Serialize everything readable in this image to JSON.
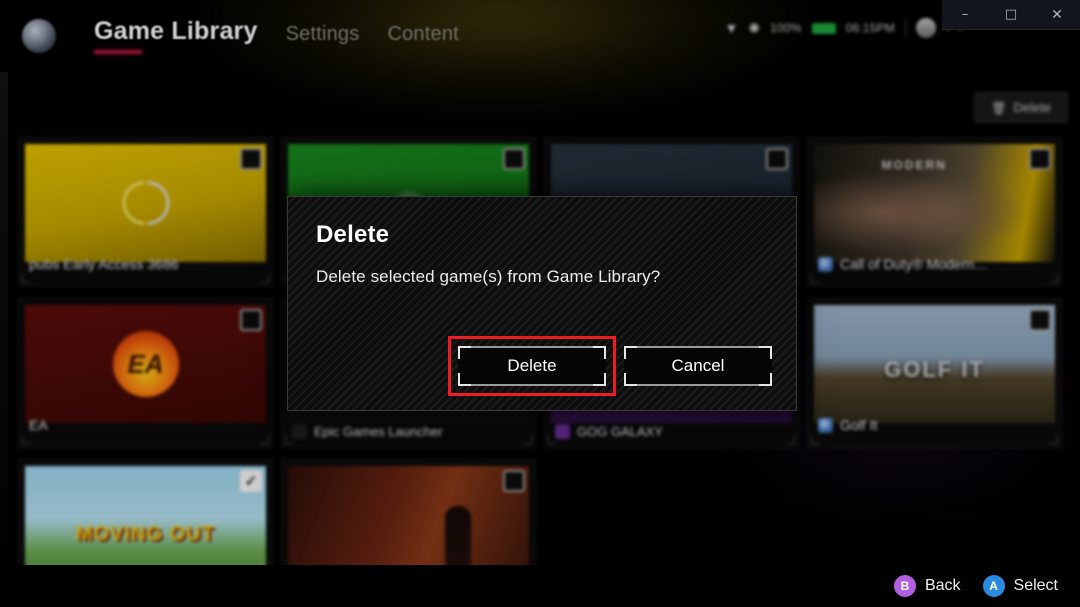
{
  "window": {
    "controls": [
      {
        "name": "minimize",
        "glyph": "–"
      },
      {
        "name": "maximize",
        "glyph": "□"
      },
      {
        "name": "close",
        "glyph": "✕"
      }
    ]
  },
  "header": {
    "logo_icon": "app-logo-icon",
    "nav": [
      {
        "label": "Game Library",
        "active": true
      },
      {
        "label": "Settings",
        "active": false
      },
      {
        "label": "Content",
        "active": false
      }
    ]
  },
  "tray": {
    "wifi_icon": "wifi-icon",
    "bluetooth_icon": "bluetooth-icon",
    "battery_percent": "100%",
    "battery_icon": "battery-icon",
    "time": "06:15PM",
    "user_icon": "user-avatar-icon",
    "chevron_left": "‹",
    "chevron_right": "›"
  },
  "toolbar": {
    "delete_label": "Delete",
    "delete_icon": "trash-icon"
  },
  "tiles": [
    {
      "title": "pubs Early Access 3686",
      "art": "art-yellow",
      "logo": "yuzu",
      "checked": false,
      "caption_on_art": true,
      "cap_icon": ""
    },
    {
      "title": "",
      "art": "art-green",
      "logo": "xbox",
      "checked": false,
      "caption_on_art": false,
      "cap_icon": ""
    },
    {
      "title": "",
      "art": "art-blue",
      "logo": "steam",
      "checked": false,
      "caption_on_art": false,
      "cap_icon": ""
    },
    {
      "title": "Call of Duty® Modern…",
      "art": "art-cod",
      "logo": "cod",
      "checked": false,
      "caption_on_art": true,
      "cap_icon": "cap-ico-blue"
    },
    {
      "title": "EA",
      "art": "art-ea",
      "logo": "ea",
      "checked": false,
      "caption_on_art": true,
      "cap_icon": ""
    },
    {
      "title": "Epic Games Launcher",
      "art": "art-epic",
      "logo": "none",
      "checked": false,
      "caption_on_art": false,
      "cap_icon": "cap-ico-epic"
    },
    {
      "title": "GOG GALAXY",
      "art": "art-gog",
      "logo": "gog",
      "checked": false,
      "caption_on_art": false,
      "cap_icon": "cap-ico-gog"
    },
    {
      "title": "Golf It",
      "art": "art-golf",
      "logo": "golf",
      "checked": false,
      "caption_on_art": true,
      "cap_icon": "cap-ico-blue"
    },
    {
      "title": "",
      "art": "art-moving",
      "logo": "moving",
      "checked": true,
      "caption_on_art": false,
      "cap_icon": ""
    },
    {
      "title": "",
      "art": "art-dark",
      "logo": "silhouette",
      "checked": false,
      "caption_on_art": false,
      "cap_icon": ""
    }
  ],
  "tile_art_text": {
    "cod_title": "MODERN",
    "golf_label": "GOLF IT",
    "moving_label": "MOVING OUT",
    "gog_label": "GOG GALAXY",
    "ea_mark": "EA"
  },
  "dialog": {
    "title": "Delete",
    "message": "Delete selected game(s) from Game Library?",
    "confirm_label": "Delete",
    "cancel_label": "Cancel",
    "focused_button": "Delete",
    "focus_ring_color": "#ee1d24"
  },
  "hintbar": {
    "hints": [
      {
        "badge": "B",
        "label": "Back",
        "color": "#b05fe0"
      },
      {
        "badge": "A",
        "label": "Select",
        "color": "#2a8ae0"
      }
    ]
  },
  "checkbox_glyph": "✓"
}
